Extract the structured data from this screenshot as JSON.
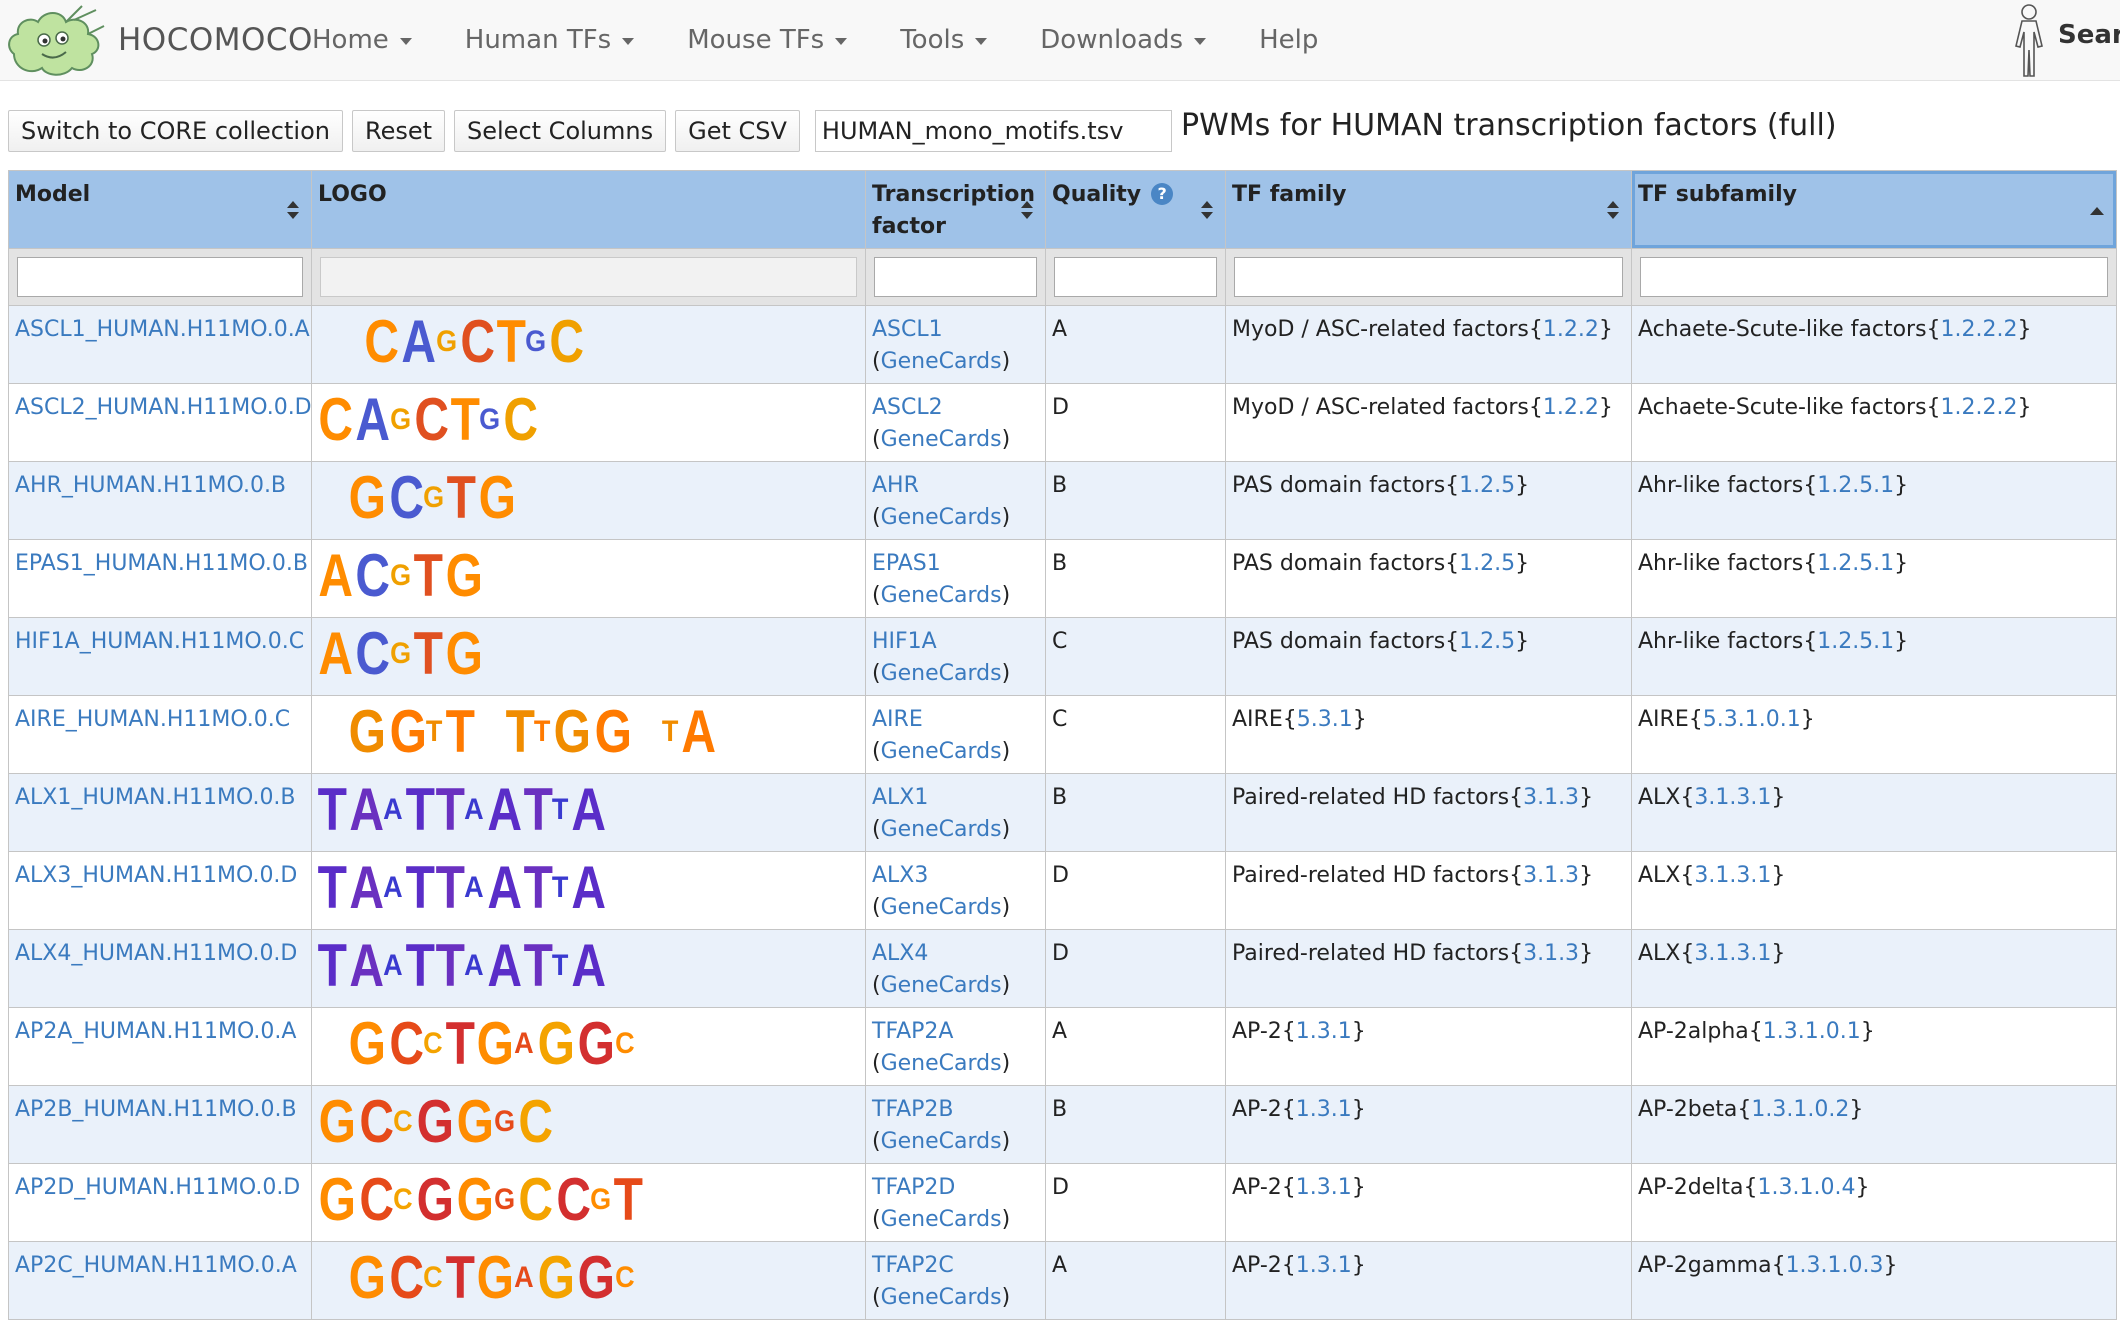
{
  "brand": {
    "name": "HOCOMOCO",
    "logo_icon": "amoeba-logo-icon"
  },
  "nav": {
    "items": [
      {
        "label": "Home",
        "dropdown": true
      },
      {
        "label": "Human TFs",
        "dropdown": true
      },
      {
        "label": "Mouse TFs",
        "dropdown": true
      },
      {
        "label": "Tools",
        "dropdown": true
      },
      {
        "label": "Downloads",
        "dropdown": true
      },
      {
        "label": "Help",
        "dropdown": false
      }
    ],
    "search_label": "Searc",
    "search_icon": "human-body-icon"
  },
  "toolbar": {
    "switch_label": "Switch to CORE collection",
    "reset_label": "Reset",
    "select_columns_label": "Select Columns",
    "get_csv_label": "Get CSV",
    "filename_value": "HUMAN_mono_motifs.tsv"
  },
  "page_title": "PWMs for HUMAN transcription factors (full)",
  "table": {
    "headers": {
      "model": "Model",
      "logo": "LOGO",
      "tf_line1": "Transcription",
      "tf_line2": "factor",
      "quality": "Quality",
      "quality_help": "?",
      "family": "TF family",
      "subfamily": "TF subfamily"
    },
    "sorted_column": "TF subfamily",
    "colors": {
      "header_bg": "#9fc2e8",
      "link": "#3a7abf",
      "odd_row": "#eaf1fa"
    },
    "rows": [
      {
        "model": "ASCL1_HUMAN.H11MO.0.A",
        "tf": "ASCL1",
        "genecards": "GeneCards",
        "quality": "A",
        "family": "MyoD / ASC-related factors",
        "family_id": "1.2.2",
        "subfamily": "Achaete-Scute-like factors",
        "subfamily_id": "1.2.2.2",
        "logo": "CAGCTGC"
      },
      {
        "model": "ASCL2_HUMAN.H11MO.0.D",
        "tf": "ASCL2",
        "genecards": "GeneCards",
        "quality": "D",
        "family": "MyoD / ASC-related factors",
        "family_id": "1.2.2",
        "subfamily": "Achaete-Scute-like factors",
        "subfamily_id": "1.2.2.2",
        "logo": "CAGCTGC"
      },
      {
        "model": "AHR_HUMAN.H11MO.0.B",
        "tf": "AHR",
        "genecards": "GeneCards",
        "quality": "B",
        "family": "PAS domain factors",
        "family_id": "1.2.5",
        "subfamily": "Ahr-like factors",
        "subfamily_id": "1.2.5.1",
        "logo": "GCGTG"
      },
      {
        "model": "EPAS1_HUMAN.H11MO.0.B",
        "tf": "EPAS1",
        "genecards": "GeneCards",
        "quality": "B",
        "family": "PAS domain factors",
        "family_id": "1.2.5",
        "subfamily": "Ahr-like factors",
        "subfamily_id": "1.2.5.1",
        "logo": "ACGTG"
      },
      {
        "model": "HIF1A_HUMAN.H11MO.0.C",
        "tf": "HIF1A",
        "genecards": "GeneCards",
        "quality": "C",
        "family": "PAS domain factors",
        "family_id": "1.2.5",
        "subfamily": "Ahr-like factors",
        "subfamily_id": "1.2.5.1",
        "logo": "ACGTG"
      },
      {
        "model": "AIRE_HUMAN.H11MO.0.C",
        "tf": "AIRE",
        "genecards": "GeneCards",
        "quality": "C",
        "family": "AIRE",
        "family_id": "5.3.1",
        "subfamily": "AIRE",
        "subfamily_id": "5.3.1.0.1",
        "logo": "GGTT TTGG TA"
      },
      {
        "model": "ALX1_HUMAN.H11MO.0.B",
        "tf": "ALX1",
        "genecards": "GeneCards",
        "quality": "B",
        "family": "Paired-related HD factors",
        "family_id": "3.1.3",
        "subfamily": "ALX",
        "subfamily_id": "3.1.3.1",
        "logo": "TAATTAATTA"
      },
      {
        "model": "ALX3_HUMAN.H11MO.0.D",
        "tf": "ALX3",
        "genecards": "GeneCards",
        "quality": "D",
        "family": "Paired-related HD factors",
        "family_id": "3.1.3",
        "subfamily": "ALX",
        "subfamily_id": "3.1.3.1",
        "logo": "TAATTAATTA"
      },
      {
        "model": "ALX4_HUMAN.H11MO.0.D",
        "tf": "ALX4",
        "genecards": "GeneCards",
        "quality": "D",
        "family": "Paired-related HD factors",
        "family_id": "3.1.3",
        "subfamily": "ALX",
        "subfamily_id": "3.1.3.1",
        "logo": "TAATTAATTA"
      },
      {
        "model": "AP2A_HUMAN.H11MO.0.A",
        "tf": "TFAP2A",
        "genecards": "GeneCards",
        "quality": "A",
        "family": "AP-2",
        "family_id": "1.3.1",
        "subfamily": "AP-2alpha",
        "subfamily_id": "1.3.1.0.1",
        "logo": "GCCTGAGGC"
      },
      {
        "model": "AP2B_HUMAN.H11MO.0.B",
        "tf": "TFAP2B",
        "genecards": "GeneCards",
        "quality": "B",
        "family": "AP-2",
        "family_id": "1.3.1",
        "subfamily": "AP-2beta",
        "subfamily_id": "1.3.1.0.2",
        "logo": "GCCGGGC"
      },
      {
        "model": "AP2D_HUMAN.H11MO.0.D",
        "tf": "TFAP2D",
        "genecards": "GeneCards",
        "quality": "D",
        "family": "AP-2",
        "family_id": "1.3.1",
        "subfamily": "AP-2delta",
        "subfamily_id": "1.3.1.0.4",
        "logo": "GCCGGGCCGT"
      },
      {
        "model": "AP2C_HUMAN.H11MO.0.A",
        "tf": "TFAP2C",
        "genecards": "GeneCards",
        "quality": "A",
        "family": "AP-2",
        "family_id": "1.3.1",
        "subfamily": "AP-2gamma",
        "subfamily_id": "1.3.1.0.3",
        "logo": "GCCTGAGGC"
      }
    ]
  }
}
